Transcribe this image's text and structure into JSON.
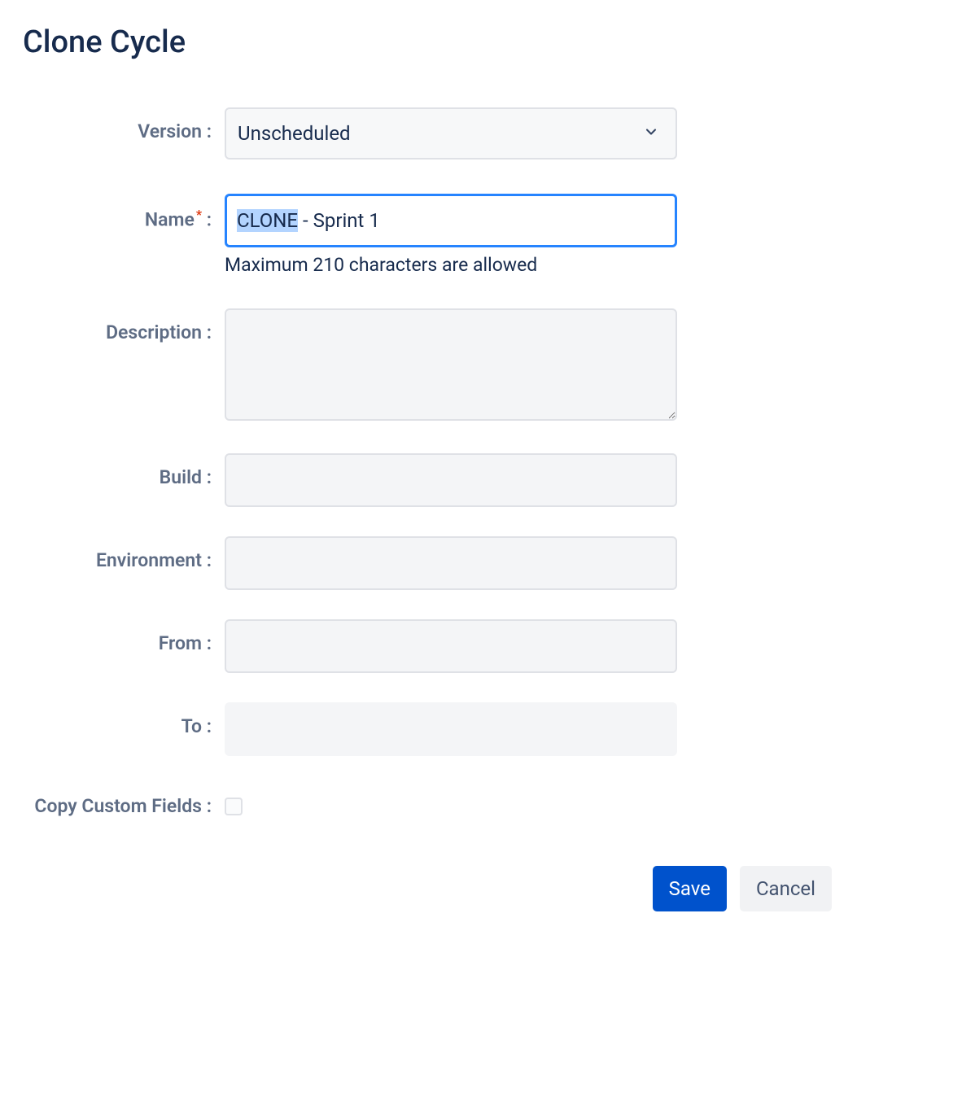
{
  "dialog": {
    "title": "Clone Cycle"
  },
  "fields": {
    "version": {
      "label": "Version :",
      "value": "Unscheduled"
    },
    "name": {
      "label": "Name",
      "label_suffix": " :",
      "value_selected": "CLONE",
      "value_rest": " - Sprint 1",
      "hint": "Maximum 210 characters are allowed"
    },
    "description": {
      "label": "Description :",
      "value": ""
    },
    "build": {
      "label": "Build :",
      "value": ""
    },
    "environment": {
      "label": "Environment :",
      "value": ""
    },
    "from": {
      "label": "From :",
      "value": ""
    },
    "to": {
      "label": "To :",
      "value": ""
    },
    "copy_custom_fields": {
      "label": "Copy Custom Fields :",
      "checked": false
    }
  },
  "buttons": {
    "save": "Save",
    "cancel": "Cancel"
  }
}
